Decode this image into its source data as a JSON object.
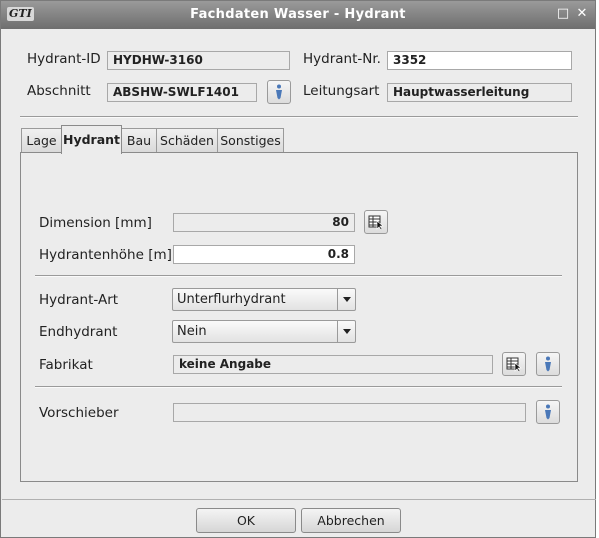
{
  "window": {
    "title": "Fachdaten Wasser - Hydrant",
    "logo_text": "GTI",
    "maximize_glyph": "□",
    "close_glyph": "✕"
  },
  "header": {
    "hydrant_id": {
      "label": "Hydrant-ID",
      "value": "HYDHW-3160"
    },
    "hydrant_nr": {
      "label": "Hydrant-Nr.",
      "value": "3352"
    },
    "abschnitt": {
      "label": "Abschnitt",
      "value": "ABSHW-SWLF1401",
      "info_icon": "info-pen-icon"
    },
    "leitungsart": {
      "label": "Leitungsart",
      "value": "Hauptwasserleitung"
    }
  },
  "tabs": [
    {
      "label": "Lage",
      "active": false
    },
    {
      "label": "Hydrant",
      "active": true
    },
    {
      "label": "Bau",
      "active": false
    },
    {
      "label": "Schäden",
      "active": false
    },
    {
      "label": "Sonstiges",
      "active": false
    }
  ],
  "hydrant_tab": {
    "dimension": {
      "label": "Dimension [mm]",
      "value": "80",
      "picker_icon": "table-picker-icon"
    },
    "hoehe": {
      "label": "Hydrantenhöhe [m]",
      "value": "0.8"
    },
    "art": {
      "label": "Hydrant-Art",
      "selected": "Unterflurhydrant"
    },
    "endhydrant": {
      "label": "Endhydrant",
      "selected": "Nein"
    },
    "fabrikat": {
      "label": "Fabrikat",
      "value": "keine Angabe",
      "picker_icon": "table-picker-icon",
      "info_icon": "info-pen-icon"
    },
    "vorschieber": {
      "label": "Vorschieber",
      "value": "",
      "info_icon": "info-pen-icon"
    }
  },
  "footer": {
    "ok_label": "OK",
    "cancel_label": "Abbrechen"
  },
  "colors": {
    "titlebar": "#7e7e7e",
    "background": "#ececec",
    "editable_field": "#ffffff",
    "icon_blue": "#4a78b8"
  }
}
